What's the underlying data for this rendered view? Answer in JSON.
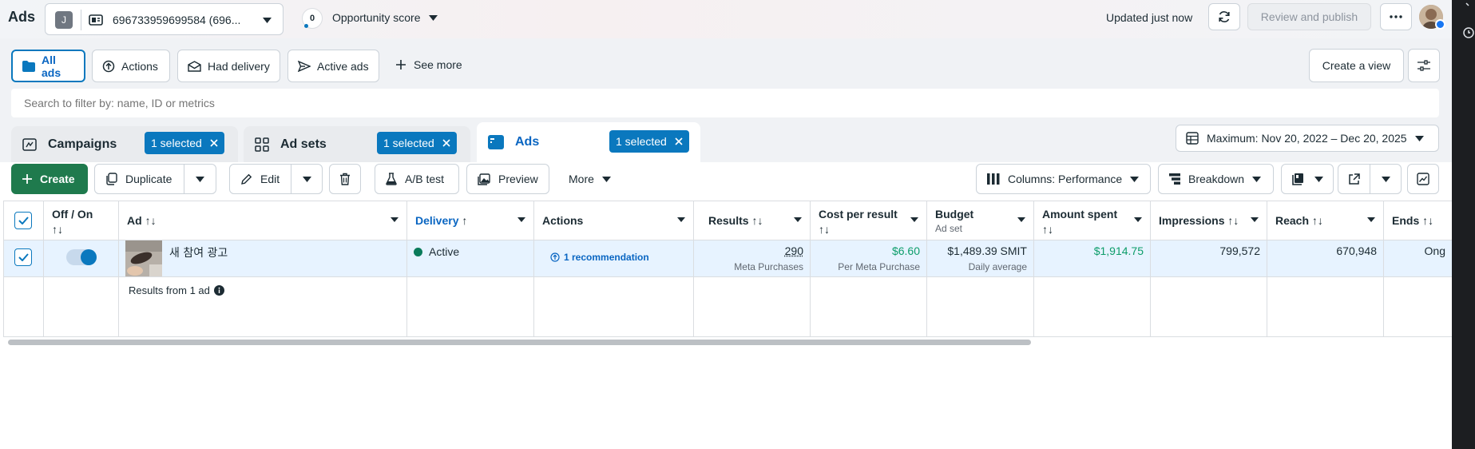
{
  "header": {
    "title": "Ads",
    "account_initial": "J",
    "account_id": "696733959699584 (696...",
    "opportunity_score_value": "0",
    "opportunity_score_label": "Opportunity score",
    "updated_text": "Updated just now",
    "review_publish_label": "Review and publish"
  },
  "filters": {
    "chips": [
      {
        "label": "All ads",
        "icon": "folder-icon",
        "active": true
      },
      {
        "label": "Actions",
        "icon": "arrow-up-circle-icon"
      },
      {
        "label": "Had delivery",
        "icon": "envelope-icon"
      },
      {
        "label": "Active ads",
        "icon": "send-icon"
      }
    ],
    "see_more_label": "See more",
    "create_view_label": "Create a view"
  },
  "search": {
    "placeholder": "Search to filter by: name, ID or metrics"
  },
  "levels": {
    "campaigns_label": "Campaigns",
    "adsets_label": "Ad sets",
    "ads_label": "Ads",
    "selected_label": "1 selected"
  },
  "date_range": "Maximum: Nov 20, 2022 – Dec 20, 2025",
  "toolbar": {
    "create_label": "Create",
    "duplicate_label": "Duplicate",
    "edit_label": "Edit",
    "ab_test_label": "A/B test",
    "preview_label": "Preview",
    "more_label": "More",
    "columns_label": "Columns: Performance",
    "breakdown_label": "Breakdown"
  },
  "table": {
    "columns": {
      "off_on": "Off / On",
      "ad": "Ad",
      "delivery": "Delivery",
      "actions": "Actions",
      "results": "Results",
      "cost_per_result": "Cost per result",
      "budget": "Budget",
      "budget_sub": "Ad set",
      "amount_spent": "Amount spent",
      "impressions": "Impressions",
      "reach": "Reach",
      "ends": "Ends"
    },
    "sort_icon_text": "↑↓",
    "delivery_sort_icon": "↑",
    "row": {
      "ad_name": "새 참여 광고",
      "delivery_status": "Active",
      "actions_text": "1 recommendation",
      "results_value": "290",
      "results_sub": "Meta Purchases",
      "cost_value": "$6.60",
      "cost_sub": "Per Meta Purchase",
      "budget_value": "$1,489.39 SMIT",
      "budget_sub": "Daily average",
      "amount_spent": "$1,914.75",
      "impressions": "799,572",
      "reach": "670,948",
      "ends": "Ong"
    },
    "summary_text": "Results from 1 ad"
  },
  "colors": {
    "accent": "#0a78be",
    "create_green": "#1f7a4d",
    "active_dot": "#0a7b5a",
    "spent_green": "#0d9d6a",
    "row_selected": "#e7f3ff"
  }
}
